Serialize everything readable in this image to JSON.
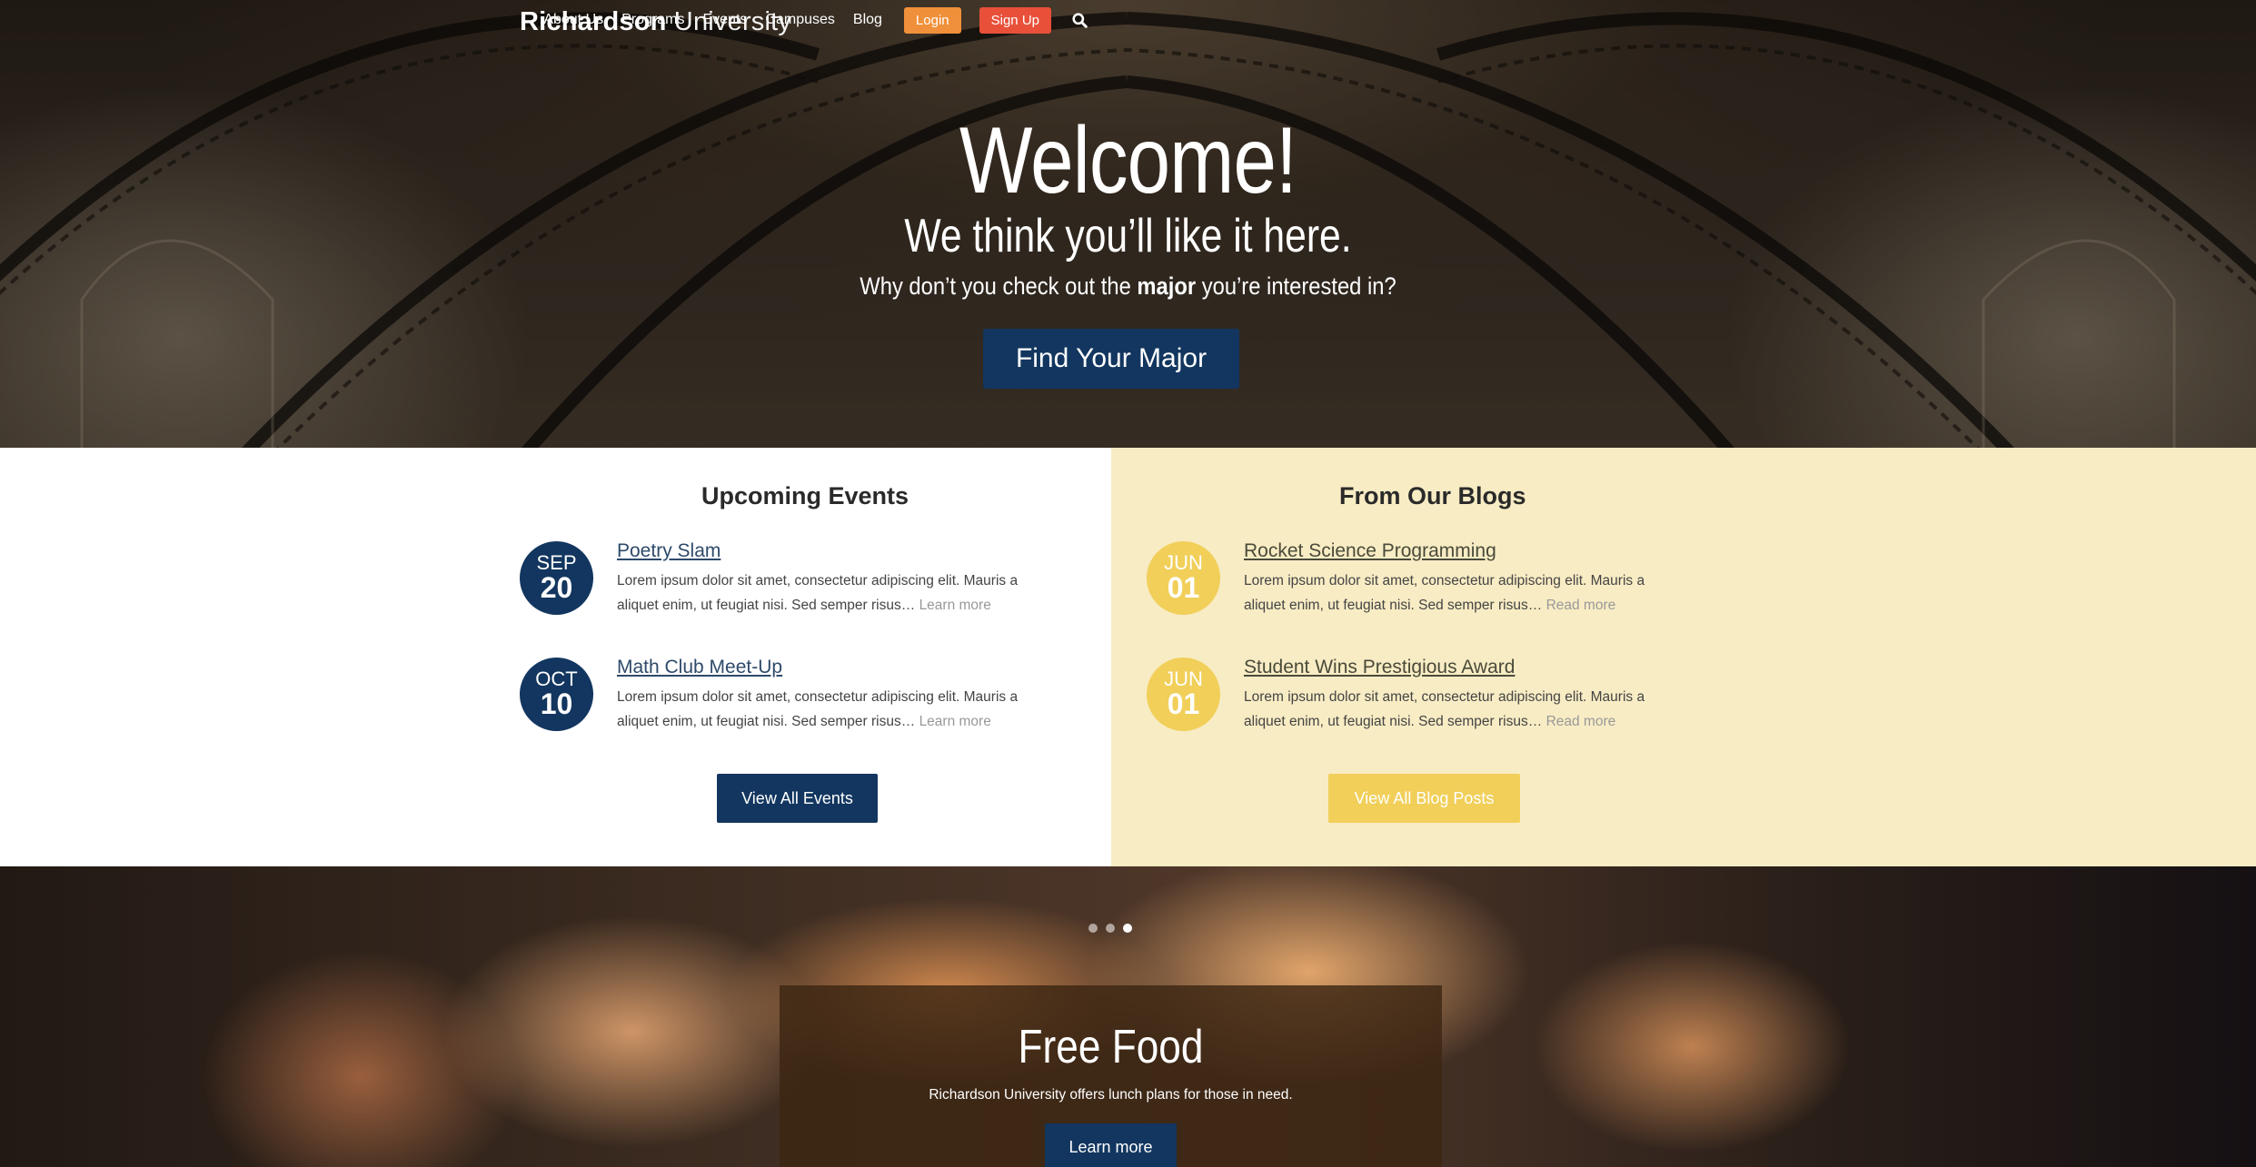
{
  "nav": {
    "brand_bold": "Richardson",
    "brand_light": "University",
    "links": [
      "About Us",
      "Programs",
      "Events",
      "Campuses",
      "Blog"
    ],
    "login_label": "Login",
    "signup_label": "Sign Up",
    "search_icon": "search-icon"
  },
  "hero": {
    "title": "Welcome!",
    "subtitle": "We think you’ll like it here.",
    "prompt_before": "Why don’t you check out the",
    "prompt_bold": "major",
    "prompt_after": "you’re interested in?",
    "cta_label": "Find Your Major"
  },
  "events": {
    "title": "Upcoming Events",
    "items": [
      {
        "month": "SEP",
        "day": "20",
        "title": "Poetry Slam",
        "desc": "Lorem ipsum dolor sit amet, consectetur adipiscing elit. Mauris a aliquet enim, ut feugiat nisi. Sed semper risus…",
        "more": "Learn more"
      },
      {
        "month": "OCT",
        "day": "10",
        "title": "Math Club Meet-Up",
        "desc": "Lorem ipsum dolor sit amet, consectetur adipiscing elit. Mauris a aliquet enim, ut feugiat nisi. Sed semper risus…",
        "more": "Learn more"
      }
    ],
    "view_all_label": "View All Events",
    "accent_color": "#12365f"
  },
  "blogs": {
    "title": "From Our Blogs",
    "items": [
      {
        "month": "JUN",
        "day": "01",
        "title": "Rocket Science Programming",
        "desc": "Lorem ipsum dolor sit amet, consectetur adipiscing elit. Mauris a aliquet enim, ut feugiat nisi. Sed semper risus…",
        "more": "Read more"
      },
      {
        "month": "JUN",
        "day": "01",
        "title": "Student Wins Prestigious Award",
        "desc": "Lorem ipsum dolor sit amet, consectetur adipiscing elit. Mauris a aliquet enim, ut feugiat nisi. Sed semper risus…",
        "more": "Read more"
      }
    ],
    "view_all_label": "View All Blog Posts",
    "accent_color": "#f1cf59"
  },
  "slider": {
    "slide_count": 3,
    "active_slide": 3,
    "title": "Free Food",
    "text": "Richardson University offers lunch plans for those in need.",
    "button_label": "Learn more"
  },
  "colors": {
    "navy": "#12365f",
    "gold": "#f1cf59",
    "cream": "#f8ecc4",
    "login_orange": "#f0903a",
    "signup_red": "#e8503a"
  }
}
